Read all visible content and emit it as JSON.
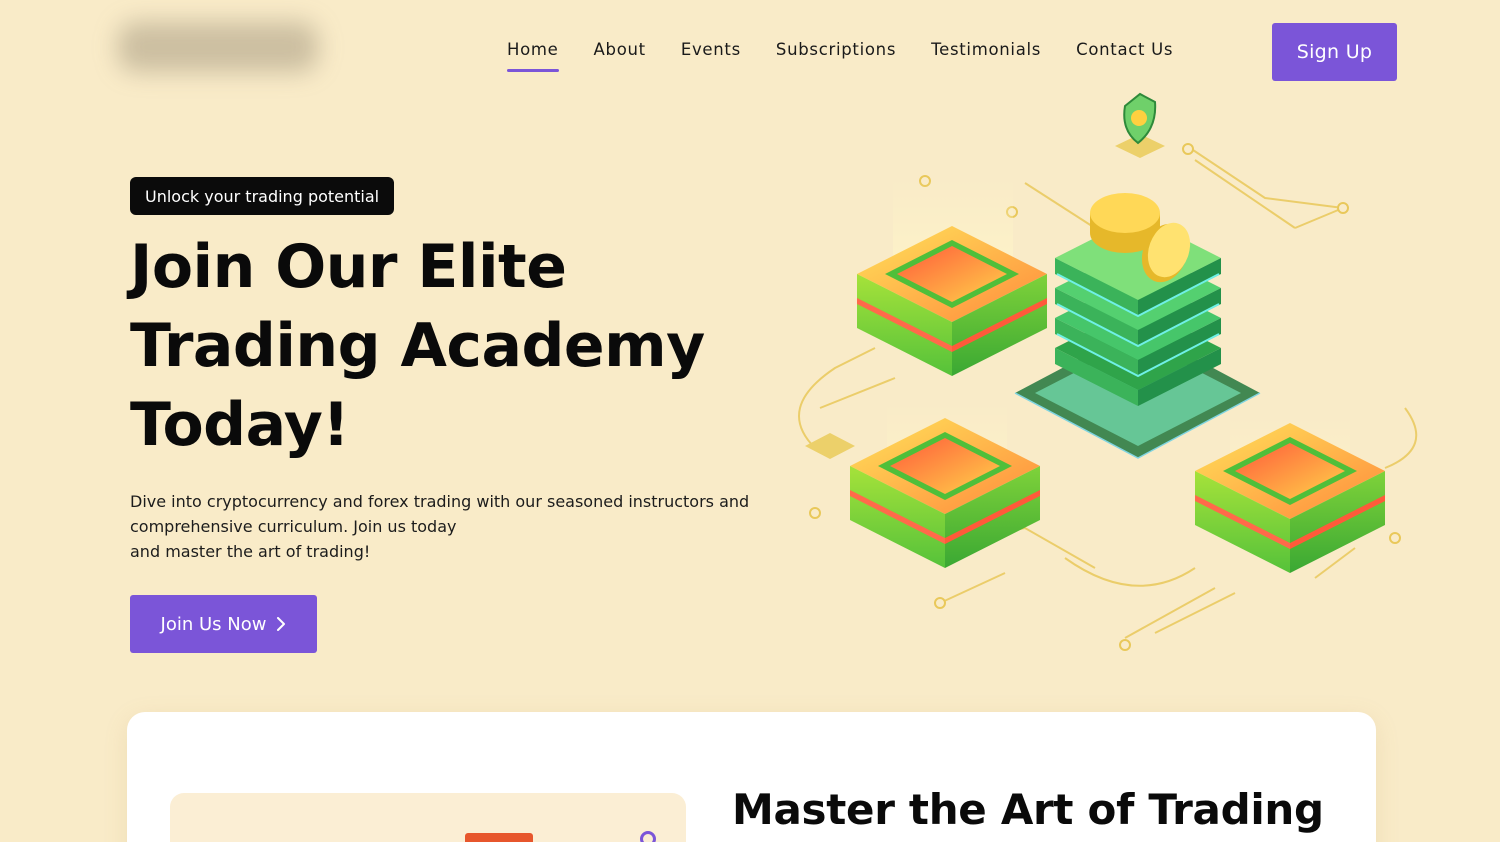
{
  "nav": {
    "items": [
      {
        "label": "Home",
        "active": true
      },
      {
        "label": "About"
      },
      {
        "label": "Events"
      },
      {
        "label": "Subscriptions"
      },
      {
        "label": "Testimonials"
      },
      {
        "label": "Contact Us"
      }
    ],
    "signup_label": "Sign Up"
  },
  "hero": {
    "badge": "Unlock your trading potential",
    "headline_lines": [
      "Join Our Elite",
      "Trading Academy",
      "Today!"
    ],
    "description_lines": [
      "Dive into cryptocurrency and forex trading with our seasoned instructors and",
      "comprehensive curriculum. Join us today",
      "and master the art of trading!"
    ],
    "cta_label": "Join Us Now"
  },
  "section": {
    "title": "Master the Art of Trading"
  },
  "colors": {
    "accent": "#7b55d8",
    "background": "#f9ebc8"
  }
}
